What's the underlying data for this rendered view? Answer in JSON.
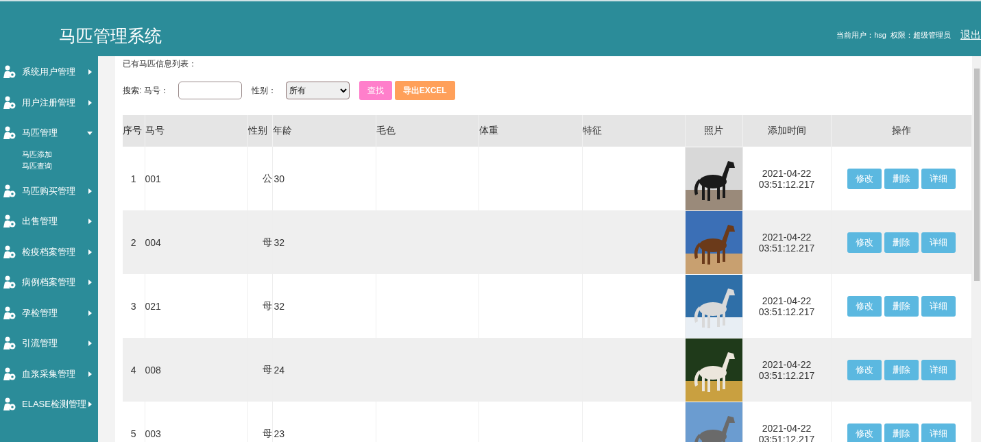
{
  "header": {
    "title": "马匹管理系统",
    "user_info": "当前用户：hsg  权限：超级管理员",
    "logout": "退出"
  },
  "sidebar": {
    "items": [
      {
        "label": "系统用户管理",
        "expanded": false
      },
      {
        "label": "用户注册管理",
        "expanded": false
      },
      {
        "label": "马匹管理",
        "expanded": true,
        "children": [
          {
            "label": "马匹添加"
          },
          {
            "label": "马匹查询"
          }
        ]
      },
      {
        "label": "马匹购买管理",
        "expanded": false
      },
      {
        "label": "出售管理",
        "expanded": false
      },
      {
        "label": "检疫档案管理",
        "expanded": false
      },
      {
        "label": "病例档案管理",
        "expanded": false
      },
      {
        "label": "孕检管理",
        "expanded": false
      },
      {
        "label": "引流管理",
        "expanded": false
      },
      {
        "label": "血浆采集管理",
        "expanded": false
      },
      {
        "label": "ELASE检测管理",
        "expanded": false
      }
    ]
  },
  "list_title": "已有马匹信息列表：",
  "search": {
    "label": "搜索: 马号：",
    "sex_label": "性别：",
    "sex_value": "所有",
    "find_button": "查找",
    "export_button": "导出EXCEL"
  },
  "table": {
    "columns": [
      "序号",
      "马号",
      "性别",
      "年龄",
      "毛色",
      "体重",
      "特征",
      "照片",
      "添加时间",
      "操作"
    ],
    "rows": [
      {
        "index": "1",
        "number": "001",
        "sex": "公",
        "age": "30",
        "added": "2021-04-22 03:51:12.217",
        "actions": [
          "修改",
          "删除",
          "详细"
        ]
      },
      {
        "index": "2",
        "number": "004",
        "sex": "母",
        "age": "32",
        "added": "2021-04-22 03:51:12.217",
        "actions": [
          "修改",
          "删除",
          "详细"
        ]
      },
      {
        "index": "3",
        "number": "021",
        "sex": "母",
        "age": "32",
        "added": "2021-04-22 03:51:12.217",
        "actions": [
          "修改",
          "删除",
          "详细"
        ]
      },
      {
        "index": "4",
        "number": "008",
        "sex": "母",
        "age": "24",
        "added": "2021-04-22 03:51:12.217",
        "actions": [
          "修改",
          "删除",
          "详细"
        ]
      },
      {
        "index": "5",
        "number": "003",
        "sex": "母",
        "age": "23",
        "added": "2021-04-22 03:51:12.217",
        "actions": [
          "修改",
          "删除",
          "详细"
        ]
      }
    ]
  }
}
